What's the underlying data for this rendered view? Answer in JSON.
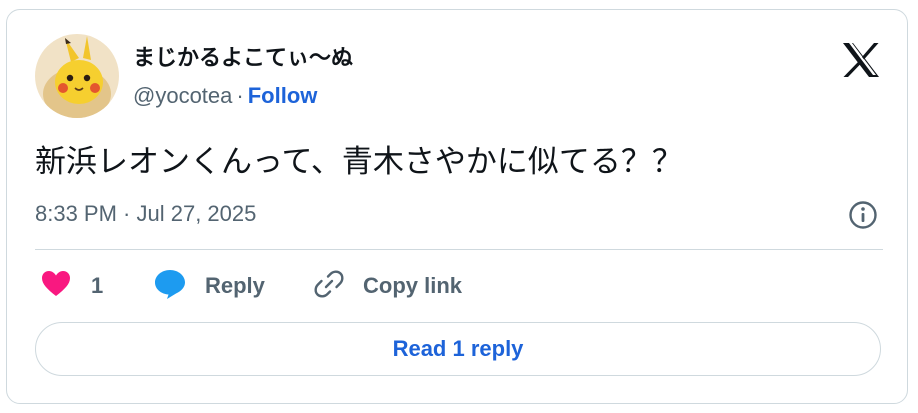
{
  "author": {
    "display_name": "まじかるよこてぃ〜ぬ",
    "handle": "@yocotea",
    "separator": "·",
    "follow_label": "Follow",
    "avatar_icon": "pikachu-avatar-icon"
  },
  "tweet": {
    "text": "新浜レオンくんって、青木さやかに似てる？？",
    "timestamp": "8:33 PM · Jul 27, 2025"
  },
  "actions": {
    "like_count": "1",
    "reply_label": "Reply",
    "copy_link_label": "Copy link",
    "read_replies_label": "Read 1 reply"
  },
  "colors": {
    "text": "#0f1419",
    "secondary": "#536471",
    "link": "#1d63d9",
    "like": "#f91880",
    "reply_bubble": "#1d9bf0",
    "border": "#cfd9de"
  },
  "icons": [
    "x-logo-icon",
    "info-icon",
    "heart-icon",
    "reply-bubble-icon",
    "link-icon"
  ]
}
